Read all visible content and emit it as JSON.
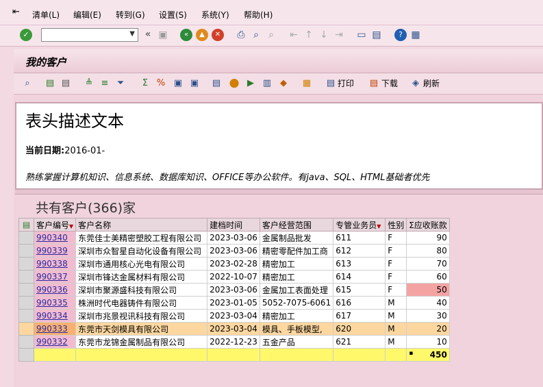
{
  "menu": {
    "items": [
      "清单(L)",
      "编辑(E)",
      "转到(G)",
      "设置(S)",
      "系统(Y)",
      "帮助(H)"
    ]
  },
  "toolbar": {
    "command_value": "",
    "back_symbol": "«"
  },
  "panel": {
    "title": "我的客户"
  },
  "alv_toolbar": {
    "print_label": "打印",
    "download_label": "下载",
    "refresh_label": "刷新"
  },
  "header": {
    "title": "表头描述文本",
    "date_label": "当前日期:",
    "date_value": "2016-01-",
    "description": "熟练掌握计算机知识、信息系统、数据库知识、OFFICE等办公软件。有java、SQL、HTML基础者优先"
  },
  "grid": {
    "count_label": "共有客户(366)家",
    "columns": [
      "客户编号",
      "客户名称",
      "建档时间",
      "客户经营范围",
      "专管业务员",
      "性别",
      "Σ应收账款"
    ],
    "rows": [
      {
        "id": "990340",
        "name": "东莞佳士美精密塑胶工程有限公司",
        "date": "2023-03-06",
        "scope": "金属制品批发",
        "rep": "611",
        "gender": "F",
        "amount": "90"
      },
      {
        "id": "990339",
        "name": "深圳市众智星自动化设备有限公司",
        "date": "2023-03-06",
        "scope": "精密零配件加工商",
        "rep": "612",
        "gender": "F",
        "amount": "80"
      },
      {
        "id": "990338",
        "name": "深圳市通用核心光电有限公司",
        "date": "2023-02-28",
        "scope": "精密加工",
        "rep": "613",
        "gender": "F",
        "amount": "70"
      },
      {
        "id": "990337",
        "name": "深圳市锋达金属材料有限公司",
        "date": "2022-10-07",
        "scope": "精密加工",
        "rep": "614",
        "gender": "F",
        "amount": "60"
      },
      {
        "id": "990336",
        "name": "深圳市聚源盛科技有限公司",
        "date": "2023-03-06",
        "scope": "金属加工表面处理",
        "rep": "615",
        "gender": "F",
        "amount": "50"
      },
      {
        "id": "990335",
        "name": "株洲时代电器铸件有限公司",
        "date": "2023-01-05",
        "scope": "5052-7075-6061",
        "rep": "616",
        "gender": "M",
        "amount": "40"
      },
      {
        "id": "990334",
        "name": "深圳市兆景视讯科技有限公司",
        "date": "2023-03-04",
        "scope": "精密加工",
        "rep": "617",
        "gender": "M",
        "amount": "30"
      },
      {
        "id": "990333",
        "name": "东莞市天剑模具有限公司",
        "date": "2023-03-04",
        "scope": "模具、手板模型,",
        "rep": "620",
        "gender": "M",
        "amount": "20"
      },
      {
        "id": "990332",
        "name": "东莞市龙锦金属制品有限公司",
        "date": "2022-12-23",
        "scope": "五金产品",
        "rep": "621",
        "gender": "M",
        "amount": "10"
      }
    ],
    "total_marker": "▪",
    "total": "450"
  }
}
